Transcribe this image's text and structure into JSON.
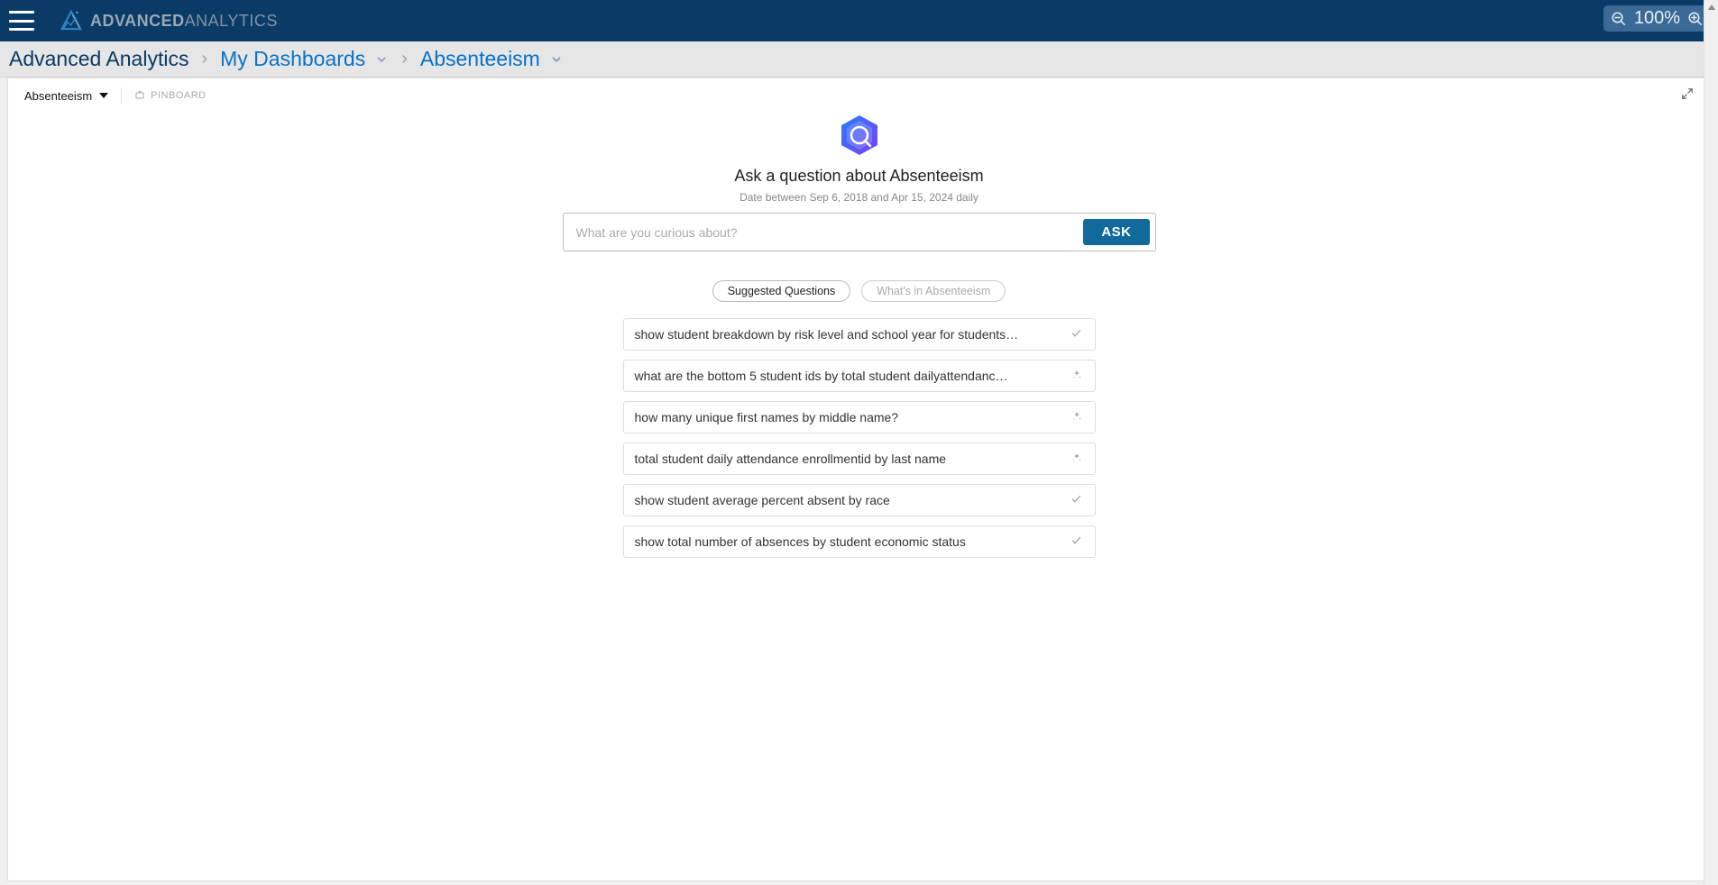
{
  "header": {
    "brand_bold": "ADVANCED",
    "brand_light": "ANALYTICS",
    "zoom_label": "100%"
  },
  "breadcrumb": {
    "root": "Advanced Analytics",
    "level1": "My Dashboards",
    "level2": "Absenteeism"
  },
  "toolbar": {
    "dropdown_label": "Absenteeism",
    "pinboard_label": "PINBOARD"
  },
  "ask": {
    "title": "Ask a question about Absenteeism",
    "subtitle": "Date between Sep 6, 2018 and Apr 15, 2024 daily",
    "placeholder": "What are you curious about?",
    "button_label": "ASK"
  },
  "tabs": {
    "suggested": "Suggested Questions",
    "whatsin": "What's in Absenteeism"
  },
  "suggestions": [
    {
      "text": "show student breakdown by risk level and school year for students…",
      "icon": "check"
    },
    {
      "text": "what are the bottom 5 student ids by total student dailyattendanc…",
      "icon": "sparkle"
    },
    {
      "text": "how many unique first names by middle name?",
      "icon": "sparkle"
    },
    {
      "text": "total student daily attendance enrollmentid by last name",
      "icon": "sparkle"
    },
    {
      "text": "show student average percent absent by race",
      "icon": "check"
    },
    {
      "text": "show total number of absences by student economic status",
      "icon": "check"
    }
  ]
}
